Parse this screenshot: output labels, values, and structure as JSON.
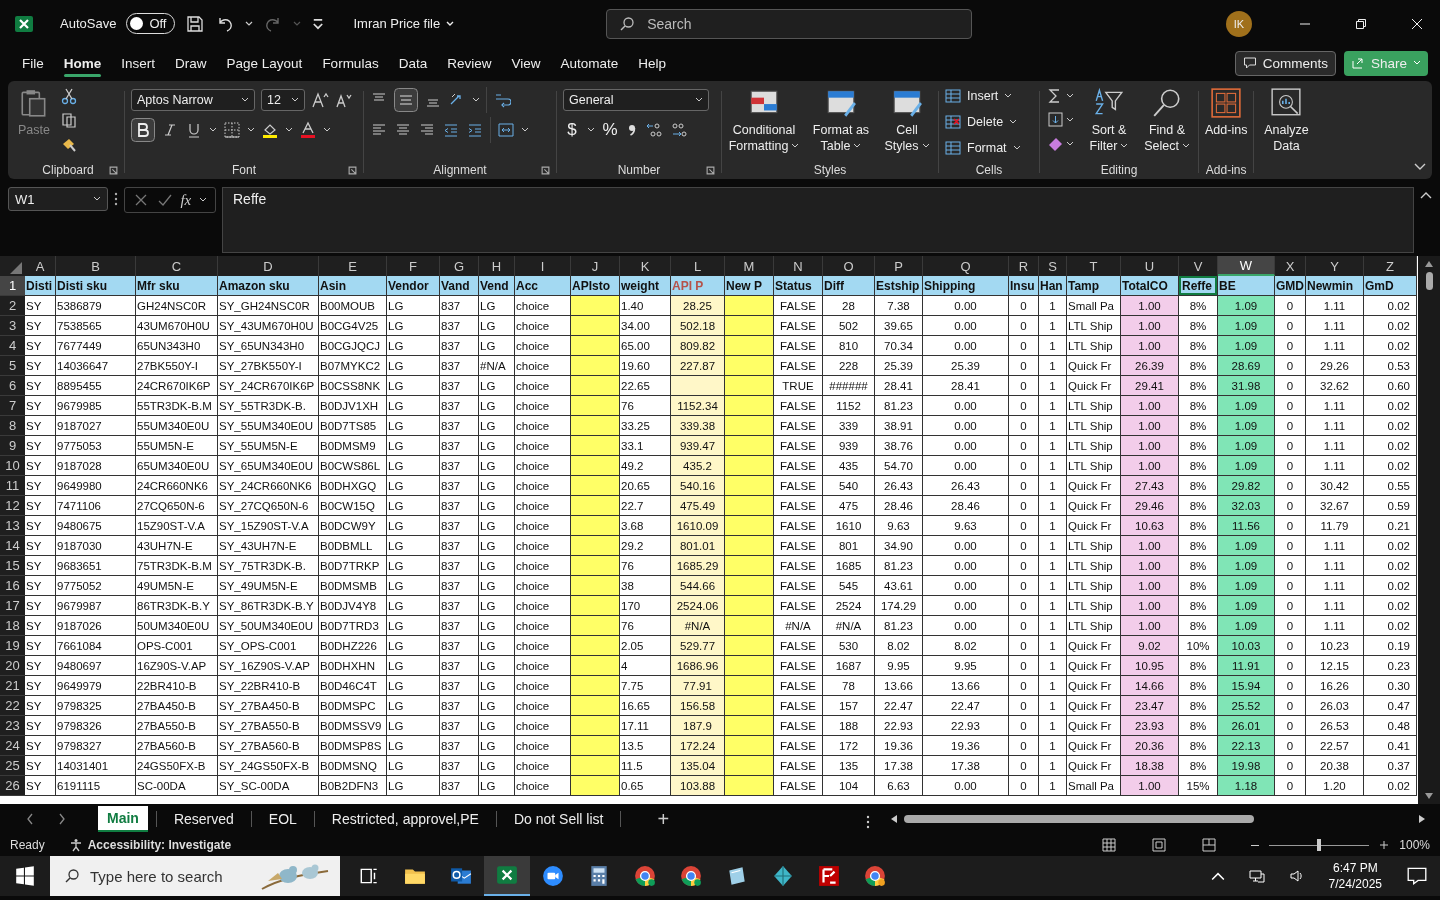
{
  "titlebar": {
    "autosave_label": "AutoSave",
    "autosave": {
      "on": false,
      "label": "Off"
    },
    "file_title": "Imran Price file",
    "search": {
      "placeholder": "Search"
    },
    "avatar": "IK"
  },
  "menu": {
    "tabs": [
      {
        "label": "File",
        "selected": false
      },
      {
        "label": "Home",
        "selected": true
      },
      {
        "label": "Insert",
        "selected": false
      },
      {
        "label": "Draw",
        "selected": false
      },
      {
        "label": "Page Layout",
        "selected": false
      },
      {
        "label": "Formulas",
        "selected": false
      },
      {
        "label": "Data",
        "selected": false
      },
      {
        "label": "Review",
        "selected": false
      },
      {
        "label": "View",
        "selected": false
      },
      {
        "label": "Automate",
        "selected": false
      },
      {
        "label": "Help",
        "selected": false
      }
    ],
    "comments": "Comments",
    "share": "Share"
  },
  "ribbon": {
    "clipboard": {
      "label": "Clipboard",
      "paste": "Paste"
    },
    "font": {
      "label": "Font",
      "family": "Aptos Narrow",
      "size": "12",
      "bold": true
    },
    "alignment": {
      "label": "Alignment",
      "middle_align": true
    },
    "number": {
      "label": "Number",
      "format": "General",
      "currency": "$",
      "percent": "%"
    },
    "styles": {
      "label": "Styles",
      "buttons": [
        "Conditional Formatting",
        "Format as Table",
        "Cell Styles"
      ]
    },
    "cells": {
      "label": "Cells",
      "buttons": [
        "Insert",
        "Delete",
        "Format"
      ]
    },
    "editing": {
      "label": "Editing",
      "buttons": [
        "Sort & Filter",
        "Find & Select"
      ]
    },
    "addins": {
      "label": "Add-ins",
      "button": "Add-ins"
    },
    "analyze": {
      "button": "Analyze Data"
    }
  },
  "formula_bar": {
    "name_box": "W1",
    "function_label": "fx",
    "formula": "Reffe"
  },
  "sheet": {
    "header_row": "1",
    "columns": [
      {
        "letter": "A",
        "heading": "Disti",
        "kind": "text",
        "selected": false,
        "active": false,
        "accent": false
      },
      {
        "letter": "B",
        "heading": "Disti sku",
        "kind": "text",
        "selected": false,
        "active": false,
        "accent": false
      },
      {
        "letter": "C",
        "heading": "Mfr sku",
        "kind": "text",
        "selected": false,
        "active": false,
        "accent": false
      },
      {
        "letter": "D",
        "heading": "Amazon sku",
        "kind": "text",
        "selected": false,
        "active": false,
        "accent": false
      },
      {
        "letter": "E",
        "heading": "Asin",
        "kind": "text",
        "selected": false,
        "active": false,
        "accent": false
      },
      {
        "letter": "F",
        "heading": "Vendor",
        "kind": "text",
        "selected": false,
        "active": false,
        "accent": false
      },
      {
        "letter": "G",
        "heading": "Vand",
        "kind": "text",
        "selected": false,
        "active": false,
        "accent": false
      },
      {
        "letter": "H",
        "heading": "Vend",
        "kind": "text",
        "selected": false,
        "active": false,
        "accent": false
      },
      {
        "letter": "I",
        "heading": "Acc",
        "kind": "text",
        "selected": false,
        "active": false,
        "accent": false
      },
      {
        "letter": "J",
        "heading": "APIsto",
        "kind": "text",
        "color": "#ffff66",
        "selected": false,
        "active": false,
        "accent": false
      },
      {
        "letter": "K",
        "heading": "weight",
        "kind": "text",
        "selected": false,
        "active": false,
        "accent": false
      },
      {
        "letter": "L",
        "heading": "API P",
        "kind": "centered",
        "color": "#fff7c8",
        "selected": false,
        "active": false,
        "accent": true
      },
      {
        "letter": "M",
        "heading": "New P",
        "kind": "text",
        "color": "#ffff66",
        "selected": false,
        "active": false,
        "accent": false
      },
      {
        "letter": "N",
        "heading": "Status",
        "kind": "centered",
        "selected": false,
        "active": false,
        "accent": false
      },
      {
        "letter": "O",
        "heading": "Diff",
        "kind": "centered",
        "selected": false,
        "active": false,
        "accent": false
      },
      {
        "letter": "P",
        "heading": "Estship",
        "kind": "centered",
        "selected": false,
        "active": false,
        "accent": false
      },
      {
        "letter": "Q",
        "heading": "Shipping",
        "kind": "centered",
        "selected": false,
        "active": false,
        "accent": false
      },
      {
        "letter": "R",
        "heading": "Insu",
        "kind": "centered",
        "selected": false,
        "active": false,
        "accent": false
      },
      {
        "letter": "S",
        "heading": "Han",
        "kind": "centered",
        "selected": false,
        "active": false,
        "accent": false
      },
      {
        "letter": "T",
        "heading": "Tamp",
        "kind": "text",
        "selected": false,
        "active": false,
        "accent": false
      },
      {
        "letter": "U",
        "heading": "TotalCO",
        "kind": "centered",
        "color": "#f3cdea",
        "selected": false,
        "active": false,
        "accent": false
      },
      {
        "letter": "V",
        "heading": "Reffe",
        "kind": "centered",
        "selected": false,
        "active": true,
        "accent": false
      },
      {
        "letter": "W",
        "heading": "BE",
        "kind": "centered",
        "color": "#80e5b6",
        "selected": true,
        "active": false,
        "accent": false
      },
      {
        "letter": "X",
        "heading": "GMD",
        "kind": "centered",
        "selected": false,
        "active": false,
        "accent": false
      },
      {
        "letter": "Y",
        "heading": "Newmin",
        "kind": "centered",
        "selected": false,
        "active": false,
        "accent": false
      },
      {
        "letter": "Z",
        "heading": "GmD",
        "kind": "numeric",
        "selected": false,
        "active": false,
        "accent": false
      }
    ],
    "rows": [
      {
        "number": "2",
        "cells": [
          "SY",
          "5386879",
          "GH24NSC0R",
          "SY_GH24NSC0R",
          "B00MOUB",
          "LG",
          "837",
          "LG",
          "choice",
          null,
          "1.40",
          "28.25",
          null,
          "FALSE",
          "28",
          "7.38",
          "0.00",
          "0",
          "1",
          "Small Pa",
          "1.00",
          "8%",
          "1.09",
          "0",
          "1.11",
          "0.02"
        ]
      },
      {
        "number": "3",
        "cells": [
          "SY",
          "7538565",
          "43UM670H0U",
          "SY_43UM670H0U",
          "B0CG4V25",
          "LG",
          "837",
          "LG",
          "choice",
          null,
          "34.00",
          "502.18",
          null,
          "FALSE",
          "502",
          "39.65",
          "0.00",
          "0",
          "1",
          "LTL Ship",
          "1.00",
          "8%",
          "1.09",
          "0",
          "1.11",
          "0.02"
        ]
      },
      {
        "number": "4",
        "cells": [
          "SY",
          "7677449",
          "65UN343H0",
          "SY_65UN343H0",
          "B0CGJQCJ",
          "LG",
          "837",
          "LG",
          "choice",
          null,
          "65.00",
          "809.82",
          null,
          "FALSE",
          "810",
          "70.34",
          "0.00",
          "0",
          "1",
          "LTL Ship",
          "1.00",
          "8%",
          "1.09",
          "0",
          "1.11",
          "0.02"
        ]
      },
      {
        "number": "5",
        "cells": [
          "SY",
          "14036647",
          "27BK550Y-I",
          "SY_27BK550Y-I",
          "B07MYKC2",
          "LG",
          "837",
          "#N/A",
          "choice",
          null,
          "19.60",
          "227.87",
          null,
          "FALSE",
          "228",
          "25.39",
          "25.39",
          "0",
          "1",
          "Quick Fr",
          "26.39",
          "8%",
          "28.69",
          "0",
          "29.26",
          "0.53"
        ]
      },
      {
        "number": "6",
        "cells": [
          "SY",
          "8895455",
          "24CR670IK6P",
          "SY_24CR670IK6P",
          "B0CSS8NK",
          "LG",
          "837",
          "LG",
          "choice",
          null,
          "22.65",
          null,
          null,
          "TRUE",
          "######",
          "28.41",
          "28.41",
          "0",
          "1",
          "Quick Fr",
          "29.41",
          "8%",
          "31.98",
          "0",
          "32.62",
          "0.60"
        ]
      },
      {
        "number": "7",
        "cells": [
          "SY",
          "9679985",
          "55TR3DK-B.M",
          "SY_55TR3DK-B.",
          "B0DJV1XH",
          "LG",
          "837",
          "LG",
          "choice",
          null,
          "76",
          "1152.34",
          null,
          "FALSE",
          "1152",
          "81.23",
          "0.00",
          "0",
          "1",
          "LTL Ship",
          "1.00",
          "8%",
          "1.09",
          "0",
          "1.11",
          "0.02"
        ]
      },
      {
        "number": "8",
        "cells": [
          "SY",
          "9187027",
          "55UM340E0U",
          "SY_55UM340E0U",
          "B0D7TS85",
          "LG",
          "837",
          "LG",
          "choice",
          null,
          "33.25",
          "339.38",
          null,
          "FALSE",
          "339",
          "38.91",
          "0.00",
          "0",
          "1",
          "LTL Ship",
          "1.00",
          "8%",
          "1.09",
          "0",
          "1.11",
          "0.02"
        ]
      },
      {
        "number": "9",
        "cells": [
          "SY",
          "9775053",
          "55UM5N-E",
          "SY_55UM5N-E",
          "B0DMSM9",
          "LG",
          "837",
          "LG",
          "choice",
          null,
          "33.1",
          "939.47",
          null,
          "FALSE",
          "939",
          "38.76",
          "0.00",
          "0",
          "1",
          "LTL Ship",
          "1.00",
          "8%",
          "1.09",
          "0",
          "1.11",
          "0.02"
        ]
      },
      {
        "number": "10",
        "cells": [
          "SY",
          "9187028",
          "65UM340E0U",
          "SY_65UM340E0U",
          "B0CWS86L",
          "LG",
          "837",
          "LG",
          "choice",
          null,
          "49.2",
          "435.2",
          null,
          "FALSE",
          "435",
          "54.70",
          "0.00",
          "0",
          "1",
          "LTL Ship",
          "1.00",
          "8%",
          "1.09",
          "0",
          "1.11",
          "0.02"
        ]
      },
      {
        "number": "11",
        "cells": [
          "SY",
          "9649980",
          "24CR660NK6",
          "SY_24CR660NK6",
          "B0DHXGQ",
          "LG",
          "837",
          "LG",
          "choice",
          null,
          "20.65",
          "540.16",
          null,
          "FALSE",
          "540",
          "26.43",
          "26.43",
          "0",
          "1",
          "Quick Fr",
          "27.43",
          "8%",
          "29.82",
          "0",
          "30.42",
          "0.55"
        ]
      },
      {
        "number": "12",
        "cells": [
          "SY",
          "7471106",
          "27CQ650N-6",
          "SY_27CQ650N-6",
          "B0CW15Q",
          "LG",
          "837",
          "LG",
          "choice",
          null,
          "22.7",
          "475.49",
          null,
          "FALSE",
          "475",
          "28.46",
          "28.46",
          "0",
          "1",
          "Quick Fr",
          "29.46",
          "8%",
          "32.03",
          "0",
          "32.67",
          "0.59"
        ]
      },
      {
        "number": "13",
        "cells": [
          "SY",
          "9480675",
          "15Z90ST-V.A",
          "SY_15Z90ST-V.A",
          "B0DCW9Y",
          "LG",
          "837",
          "LG",
          "choice",
          null,
          "3.68",
          "1610.09",
          null,
          "FALSE",
          "1610",
          "9.63",
          "9.63",
          "0",
          "1",
          "Quick Fr",
          "10.63",
          "8%",
          "11.56",
          "0",
          "11.79",
          "0.21"
        ]
      },
      {
        "number": "14",
        "cells": [
          "SY",
          "9187030",
          "43UH7N-E",
          "SY_43UH7N-E",
          "B0DBMLL",
          "LG",
          "837",
          "LG",
          "choice",
          null,
          "29.2",
          "801.01",
          null,
          "FALSE",
          "801",
          "34.90",
          "0.00",
          "0",
          "1",
          "LTL Ship",
          "1.00",
          "8%",
          "1.09",
          "0",
          "1.11",
          "0.02"
        ]
      },
      {
        "number": "15",
        "cells": [
          "SY",
          "9683651",
          "75TR3DK-B.M",
          "SY_75TR3DK-B.",
          "B0D7TRKP",
          "LG",
          "837",
          "LG",
          "choice",
          null,
          "76",
          "1685.29",
          null,
          "FALSE",
          "1685",
          "81.23",
          "0.00",
          "0",
          "1",
          "LTL Ship",
          "1.00",
          "8%",
          "1.09",
          "0",
          "1.11",
          "0.02"
        ]
      },
      {
        "number": "16",
        "cells": [
          "SY",
          "9775052",
          "49UM5N-E",
          "SY_49UM5N-E",
          "B0DMSMB",
          "LG",
          "837",
          "LG",
          "choice",
          null,
          "38",
          "544.66",
          null,
          "FALSE",
          "545",
          "43.61",
          "0.00",
          "0",
          "1",
          "LTL Ship",
          "1.00",
          "8%",
          "1.09",
          "0",
          "1.11",
          "0.02"
        ]
      },
      {
        "number": "17",
        "cells": [
          "SY",
          "9679987",
          "86TR3DK-B.Y",
          "SY_86TR3DK-B.Y",
          "B0DJV4Y8",
          "LG",
          "837",
          "LG",
          "choice",
          null,
          "170",
          "2524.06",
          null,
          "FALSE",
          "2524",
          "174.29",
          "0.00",
          "0",
          "1",
          "LTL Ship",
          "1.00",
          "8%",
          "1.09",
          "0",
          "1.11",
          "0.02"
        ]
      },
      {
        "number": "18",
        "cells": [
          "SY",
          "9187026",
          "50UM340E0U",
          "SY_50UM340E0U",
          "B0D7TRD3",
          "LG",
          "837",
          "LG",
          "choice",
          null,
          "76",
          "#N/A",
          null,
          "#N/A",
          "#N/A",
          "81.23",
          "0.00",
          "0",
          "1",
          "LTL Ship",
          "1.00",
          "8%",
          "1.09",
          "0",
          "1.11",
          "0.02"
        ]
      },
      {
        "number": "19",
        "cells": [
          "SY",
          "7661084",
          "OPS-C001",
          "SY_OPS-C001",
          "B0DHZ226",
          "LG",
          "837",
          "LG",
          "choice",
          null,
          "2.05",
          "529.77",
          null,
          "FALSE",
          "530",
          "8.02",
          "8.02",
          "0",
          "1",
          "Quick Fr",
          "9.02",
          "10%",
          "10.03",
          "0",
          "10.23",
          "0.19"
        ]
      },
      {
        "number": "20",
        "cells": [
          "SY",
          "9480697",
          "16Z90S-V.AP",
          "SY_16Z90S-V.AP",
          "B0DHXHN",
          "LG",
          "837",
          "LG",
          "choice",
          null,
          "4",
          "1686.96",
          null,
          "FALSE",
          "1687",
          "9.95",
          "9.95",
          "0",
          "1",
          "Quick Fr",
          "10.95",
          "8%",
          "11.91",
          "0",
          "12.15",
          "0.23"
        ]
      },
      {
        "number": "21",
        "cells": [
          "SY",
          "9649979",
          "22BR410-B",
          "SY_22BR410-B",
          "B0D46C4T",
          "LG",
          "837",
          "LG",
          "choice",
          null,
          "7.75",
          "77.91",
          null,
          "FALSE",
          "78",
          "13.66",
          "13.66",
          "0",
          "1",
          "Quick Fr",
          "14.66",
          "8%",
          "15.94",
          "0",
          "16.26",
          "0.30"
        ]
      },
      {
        "number": "22",
        "cells": [
          "SY",
          "9798325",
          "27BA450-B",
          "SY_27BA450-B",
          "B0DMSPC",
          "LG",
          "837",
          "LG",
          "choice",
          null,
          "16.65",
          "156.58",
          null,
          "FALSE",
          "157",
          "22.47",
          "22.47",
          "0",
          "1",
          "Quick Fr",
          "23.47",
          "8%",
          "25.52",
          "0",
          "26.03",
          "0.47"
        ]
      },
      {
        "number": "23",
        "cells": [
          "SY",
          "9798326",
          "27BA550-B",
          "SY_27BA550-B",
          "B0DMSSV9",
          "LG",
          "837",
          "LG",
          "choice",
          null,
          "17.11",
          "187.9",
          null,
          "FALSE",
          "188",
          "22.93",
          "22.93",
          "0",
          "1",
          "Quick Fr",
          "23.93",
          "8%",
          "26.01",
          "0",
          "26.53",
          "0.48"
        ]
      },
      {
        "number": "24",
        "cells": [
          "SY",
          "9798327",
          "27BA560-B",
          "SY_27BA560-B",
          "B0DMSP8S",
          "LG",
          "837",
          "LG",
          "choice",
          null,
          "13.5",
          "172.24",
          null,
          "FALSE",
          "172",
          "19.36",
          "19.36",
          "0",
          "1",
          "Quick Fr",
          "20.36",
          "8%",
          "22.13",
          "0",
          "22.57",
          "0.41"
        ]
      },
      {
        "number": "25",
        "cells": [
          "SY",
          "14031401",
          "24GS50FX-B",
          "SY_24GS50FX-B",
          "B0DMSNQ",
          "LG",
          "837",
          "LG",
          "choice",
          null,
          "11.5",
          "135.04",
          null,
          "FALSE",
          "135",
          "17.38",
          "17.38",
          "0",
          "1",
          "Quick Fr",
          "18.38",
          "8%",
          "19.98",
          "0",
          "20.38",
          "0.37"
        ]
      },
      {
        "number": "26",
        "cells": [
          "SY",
          "6191115",
          "SC-00DA",
          "SY_SC-00DA",
          "B0B2DFN3",
          "LG",
          "837",
          "LG",
          "choice",
          null,
          "0.65",
          "103.88",
          null,
          "FALSE",
          "104",
          "6.63",
          "0.00",
          "0",
          "1",
          "Small Pa",
          "1.00",
          "15%",
          "1.18",
          "0",
          "1.20",
          "0.02"
        ]
      }
    ]
  },
  "sheet_tabs": [
    {
      "label": "Main",
      "selected": true
    },
    {
      "label": "Reserved",
      "selected": false
    },
    {
      "label": "EOL",
      "selected": false
    },
    {
      "label": "Restricted, approvel,PE",
      "selected": false
    },
    {
      "label": "Do not Sell list",
      "selected": false
    }
  ],
  "add_sheet": "+",
  "status_bar": {
    "ready": "Ready",
    "accessibility": "Accessibility: Investigate",
    "zoom": {
      "level": 0.5,
      "reading": "100%"
    }
  },
  "taskbar": {
    "search": {
      "placeholder": "Type here to search"
    },
    "time": "6:47 PM",
    "date": "7/24/2025"
  }
}
